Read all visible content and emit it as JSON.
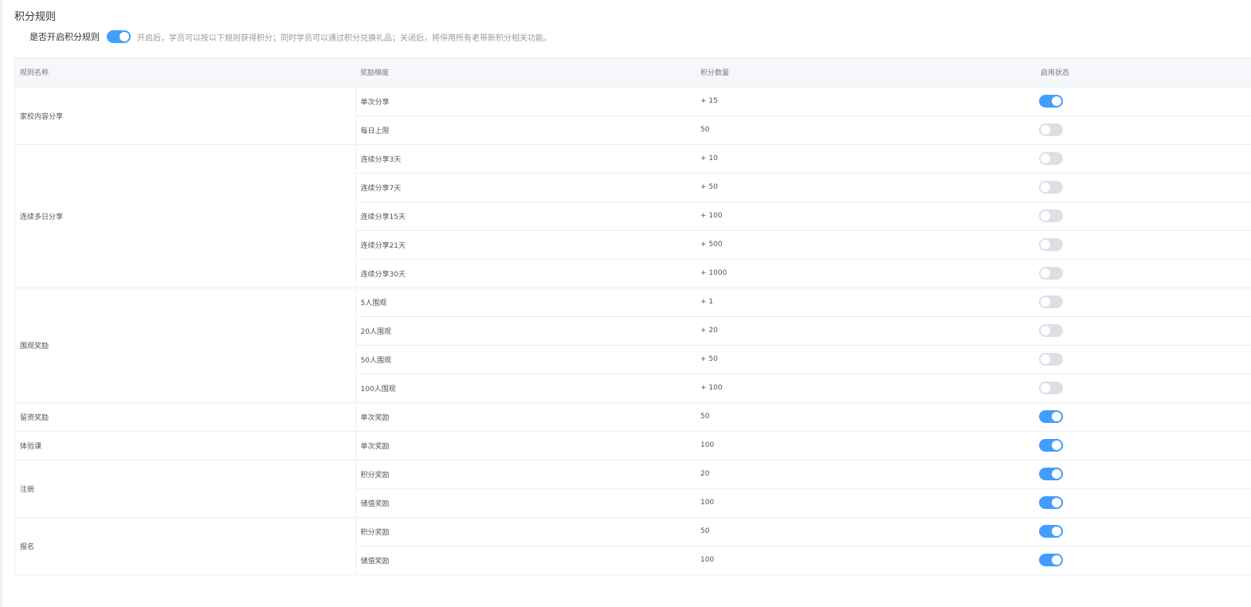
{
  "page": {
    "title": "积分规则",
    "master_toggle_label": "是否开启积分规则",
    "master_toggle_on": true,
    "master_toggle_desc": "开启后，学员可以按以下规则获得积分；同时学员可以通过积分兑换礼品；关闭后，将停用所有老带新积分相关功能。"
  },
  "table": {
    "headers": [
      "规则名称",
      "奖励梯度",
      "积分数量",
      "启用状态"
    ],
    "groups": [
      {
        "name": "家校内容分享",
        "rows": [
          {
            "tier": "单次分享",
            "points": "+ 15",
            "enabled": true
          },
          {
            "tier": "每日上限",
            "points": "50",
            "enabled": false
          }
        ]
      },
      {
        "name": "连续多日分享",
        "rows": [
          {
            "tier": "连续分享3天",
            "points": "+ 10",
            "enabled": false
          },
          {
            "tier": "连续分享7天",
            "points": "+ 50",
            "enabled": false
          },
          {
            "tier": "连续分享15天",
            "points": "+ 100",
            "enabled": false
          },
          {
            "tier": "连续分享21天",
            "points": "+ 500",
            "enabled": false
          },
          {
            "tier": "连续分享30天",
            "points": "+ 1000",
            "enabled": false
          }
        ]
      },
      {
        "name": "围观奖励",
        "rows": [
          {
            "tier": "5人围观",
            "points": "+ 1",
            "enabled": false
          },
          {
            "tier": "20人围观",
            "points": "+ 20",
            "enabled": false
          },
          {
            "tier": "50人围观",
            "points": "+ 50",
            "enabled": false
          },
          {
            "tier": "100人围观",
            "points": "+ 100",
            "enabled": false
          }
        ]
      },
      {
        "name": "留资奖励",
        "rows": [
          {
            "tier": "单次奖励",
            "points": "50",
            "enabled": true
          }
        ]
      },
      {
        "name": "体验课",
        "rows": [
          {
            "tier": "单次奖励",
            "points": "100",
            "enabled": true
          }
        ]
      },
      {
        "name": "注册",
        "rows": [
          {
            "tier": "积分奖励",
            "points": "20",
            "enabled": true
          },
          {
            "tier": "储值奖励",
            "points": "100",
            "enabled": true
          }
        ]
      },
      {
        "name": "报名",
        "rows": [
          {
            "tier": "积分奖励",
            "points": "50",
            "enabled": true
          },
          {
            "tier": "储值奖励",
            "points": "100",
            "enabled": true
          }
        ]
      }
    ]
  },
  "colors": {
    "switch_on": "#409eff",
    "switch_off": "#dcdfe6"
  }
}
